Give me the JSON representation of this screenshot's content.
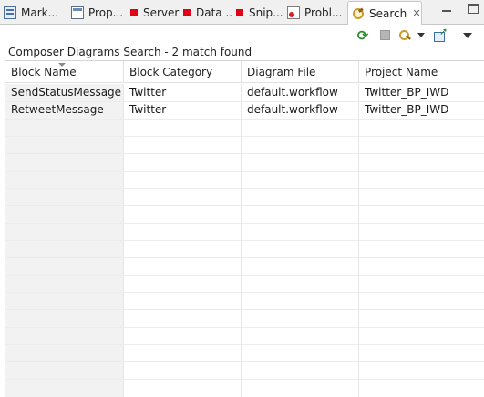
{
  "tabs": [
    {
      "label": "Mark...",
      "icon": "markers-icon"
    },
    {
      "label": "Prop...",
      "icon": "properties-icon"
    },
    {
      "label": "Servers",
      "icon": "servers-icon"
    },
    {
      "label": "Data ...",
      "icon": "data-source-icon"
    },
    {
      "label": "Snip...",
      "icon": "snippets-icon"
    },
    {
      "label": "Probl...",
      "icon": "problems-icon"
    },
    {
      "label": "Search",
      "icon": "search-icon",
      "active": true
    }
  ],
  "tab_close_glyph": "✕",
  "search": {
    "summary": "Composer Diagrams Search - 2 match found"
  },
  "table": {
    "columns": [
      "Block Name",
      "Block Category",
      "Diagram File",
      "Project Name"
    ],
    "rows": [
      [
        "SendStatusMessage",
        "Twitter",
        "default.workflow",
        "Twitter_BP_IWD"
      ],
      [
        "RetweetMessage",
        "Twitter",
        "default.workflow",
        "Twitter_BP_IWD"
      ]
    ]
  },
  "colors": {
    "tab_marker_red": "#e00018",
    "first_column_bg": "#f2f2f2"
  }
}
